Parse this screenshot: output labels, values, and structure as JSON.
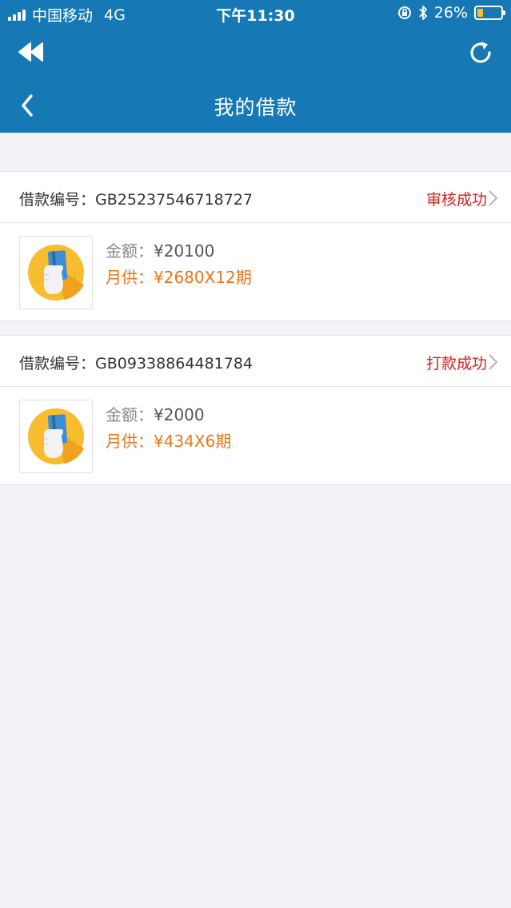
{
  "status_bar": {
    "carrier": "中国移动",
    "network": "4G",
    "time": "下午11:30",
    "battery_percent": "26%",
    "battery_level": 0.26,
    "battery_color": "#f6c026"
  },
  "header": {
    "title": "我的借款",
    "color": "#1679b5",
    "rewind_icon": "rewind-icon",
    "refresh_icon": "refresh-icon",
    "back_icon": "chevron-left-icon"
  },
  "loans": [
    {
      "number_label": "借款编号：",
      "number": "GB25237546718727",
      "status": "审核成功",
      "amount_label": "金额：",
      "amount": "¥20100",
      "monthly_label": "月供：",
      "monthly": "¥2680X12期"
    },
    {
      "number_label": "借款编号：",
      "number": "GB09338864481784",
      "status": "打款成功",
      "amount_label": "金额：",
      "amount": "¥2000",
      "monthly_label": "月供：",
      "monthly": "¥434X6期"
    }
  ],
  "colors": {
    "status_red": "#d4221c",
    "monthly_orange": "#e8761c",
    "background": "#f2f3f7"
  }
}
